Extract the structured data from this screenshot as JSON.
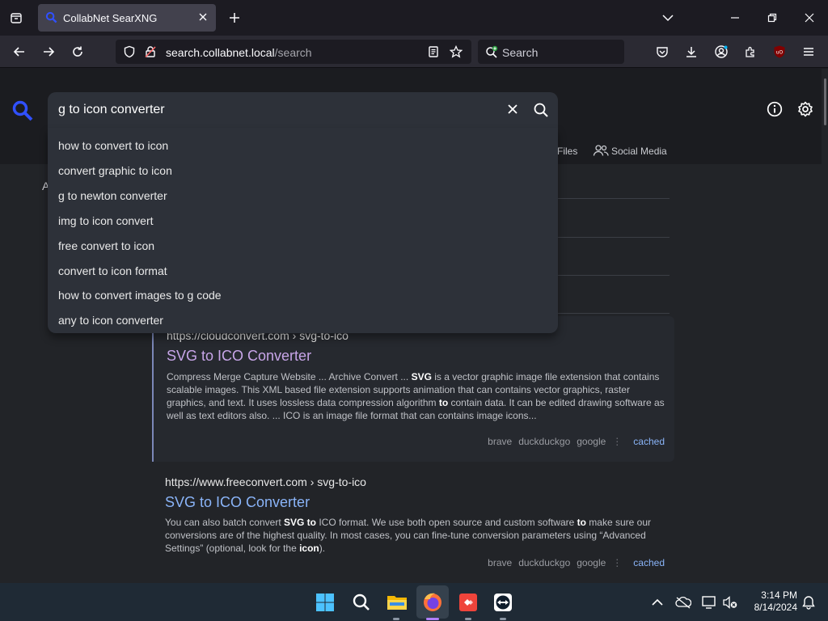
{
  "browser": {
    "tab_title": "CollabNet SearXNG",
    "url_host": "search.collabnet.local",
    "url_path": "/search",
    "search_placeholder": "Search"
  },
  "search": {
    "query": "g to icon converter",
    "suggestions": [
      "how to convert to icon",
      "convert graphic to icon",
      "g to newton converter",
      "img to icon convert",
      "free convert to icon",
      "convert to icon format",
      "how to convert images to g code",
      "any to icon converter"
    ]
  },
  "categories": {
    "files_partial": "Files",
    "social_media": "Social Media"
  },
  "partial_left_letter": "A",
  "results": [
    {
      "url": "https://cloudconvert.com",
      "path": "› svg-to-ico",
      "title": "SVG to ICO Converter",
      "snippet_parts": [
        {
          "t": "Compress Merge Capture Website ... Archive Convert ... ",
          "b": false
        },
        {
          "t": "SVG",
          "b": true
        },
        {
          "t": " is a vector graphic image file extension that contains scalable images. This XML based file extension supports animation that can contains vector graphics, raster graphics, and text. It uses lossless data compression algorithm ",
          "b": false
        },
        {
          "t": "to",
          "b": true
        },
        {
          "t": " contain data. It can be edited drawing software as well as text editors also. ... ICO is an image file format that can contains image icons...",
          "b": false
        }
      ],
      "engines": [
        "brave",
        "duckduckgo",
        "google"
      ],
      "cached": "cached"
    },
    {
      "url": "https://www.freeconvert.com",
      "path": "› svg-to-ico",
      "title": "SVG to ICO Converter",
      "snippet_parts": [
        {
          "t": "You can also batch convert ",
          "b": false
        },
        {
          "t": "SVG to",
          "b": true
        },
        {
          "t": " ICO format. We use both open source and custom software ",
          "b": false
        },
        {
          "t": "to",
          "b": true
        },
        {
          "t": " make sure our conversions are of the highest quality. In most cases, you can fine-tune conversion parameters using “Advanced Settings” (optional, look for the ",
          "b": false
        },
        {
          "t": "icon",
          "b": true
        },
        {
          "t": ").",
          "b": false
        }
      ],
      "engines": [
        "brave",
        "duckduckgo",
        "google"
      ],
      "cached": "cached"
    }
  ],
  "taskbar": {
    "time": "3:14 PM",
    "date": "8/14/2024"
  },
  "colors": {
    "accent": "#3050ff",
    "link": "#8ab4f8",
    "visited": "#c7a5e8"
  }
}
